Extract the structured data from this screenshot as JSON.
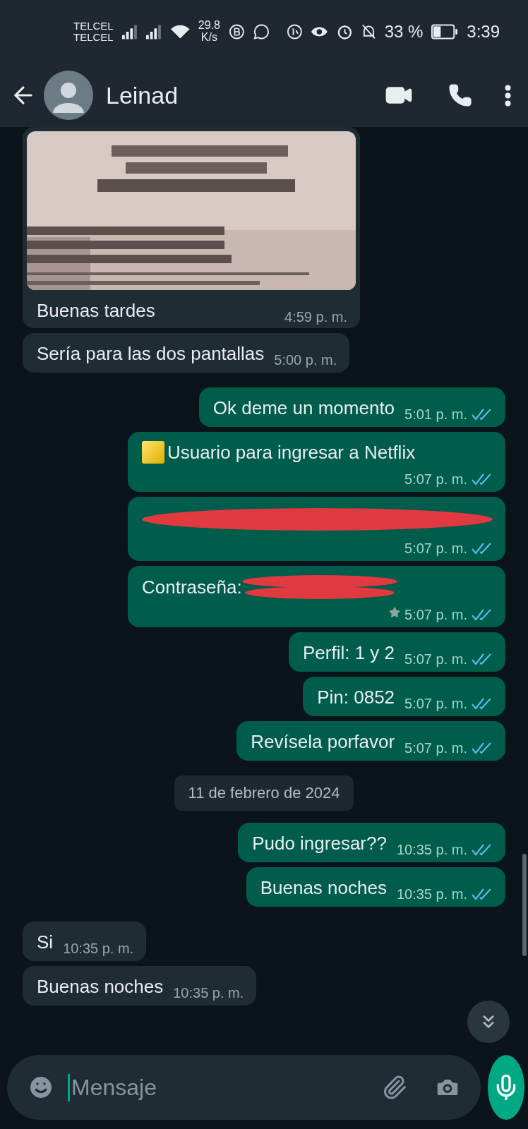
{
  "status_bar": {
    "carriers": [
      "TELCEL",
      "TELCEL"
    ],
    "speed": [
      "29.8",
      "K/s"
    ],
    "battery": "33 %",
    "time": "3:39"
  },
  "header": {
    "contact": "Leinad"
  },
  "messages": [
    {
      "kind": "incoming",
      "photo": true,
      "text": "Buenas tardes",
      "time": "4:59 p. m."
    },
    {
      "kind": "incoming",
      "text": "Sería para las dos pantallas",
      "time": "5:00 p. m."
    },
    {
      "kind": "outgoing",
      "text": "Ok deme un momento",
      "time": "5:01 p. m.",
      "read": true
    },
    {
      "kind": "outgoing",
      "square_emoji": true,
      "text": "Usuario para ingresar a Netflix",
      "time": "5:07 p. m.",
      "read": true
    },
    {
      "kind": "outgoing",
      "redacted": true,
      "time": "5:07 p. m.",
      "read": true
    },
    {
      "kind": "outgoing",
      "text": "Contraseña:",
      "redacted": true,
      "starred": true,
      "time": "5:07 p. m.",
      "read": true
    },
    {
      "kind": "outgoing",
      "text": "Perfil: 1 y 2",
      "time": "5:07 p. m.",
      "read": true
    },
    {
      "kind": "outgoing",
      "text": "Pin: 0852",
      "time": "5:07 p. m.",
      "read": true
    },
    {
      "kind": "outgoing",
      "text": "Revísela porfavor",
      "time": "5:07 p. m.",
      "read": true
    },
    {
      "kind": "date",
      "text": "11 de febrero de 2024"
    },
    {
      "kind": "outgoing",
      "text": "Pudo ingresar??",
      "time": "10:35 p. m.",
      "read": true
    },
    {
      "kind": "outgoing",
      "text": "Buenas noches",
      "time": "10:35 p. m.",
      "read": true
    },
    {
      "kind": "incoming",
      "text": "Si",
      "time": "10:35 p. m."
    },
    {
      "kind": "incoming",
      "text": "Buenas noches",
      "time": "10:35 p. m."
    }
  ],
  "composer": {
    "placeholder": "Mensaje"
  }
}
